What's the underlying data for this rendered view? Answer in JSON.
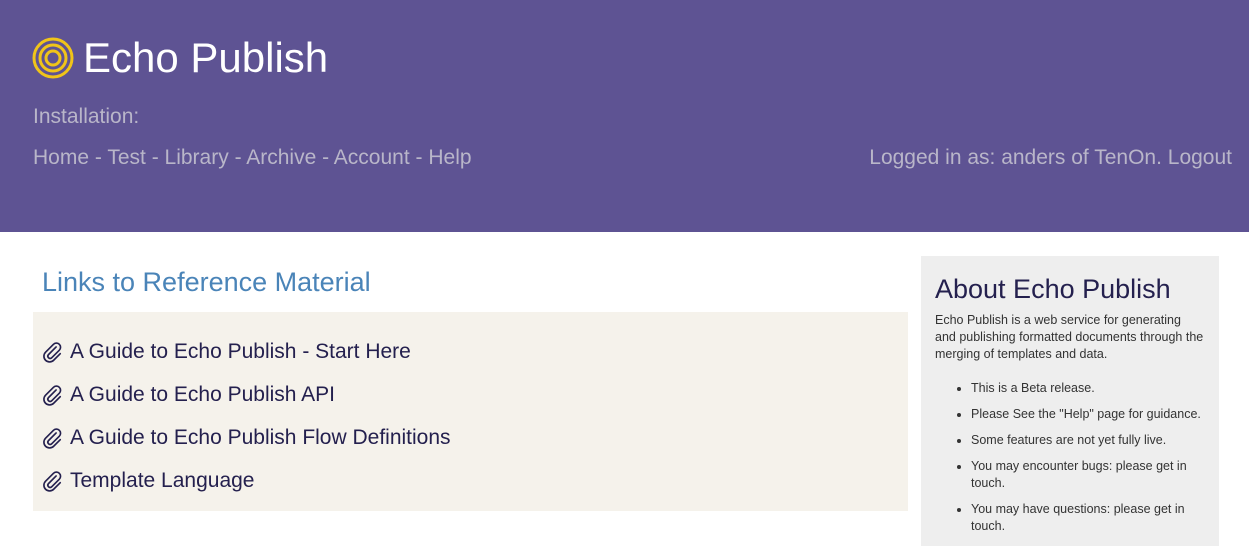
{
  "header": {
    "logo_icon": "concentric-circles-logo-icon",
    "brand_name": "Echo Publish",
    "installation_label": "Installation:",
    "nav": [
      {
        "label": "Home"
      },
      {
        "label": "Test"
      },
      {
        "label": "Library"
      },
      {
        "label": "Archive"
      },
      {
        "label": "Account"
      },
      {
        "label": "Help"
      }
    ],
    "nav_separator": "-",
    "login_text": "Logged in as: anders of TenOn.",
    "logout_label": "Logout"
  },
  "main": {
    "title": "Links to Reference Material",
    "links": [
      {
        "icon": "paperclip-icon",
        "label": "A Guide to Echo Publish - Start Here"
      },
      {
        "icon": "paperclip-icon",
        "label": "A Guide to Echo Publish API"
      },
      {
        "icon": "paperclip-icon",
        "label": "A Guide to Echo Publish Flow Definitions"
      },
      {
        "icon": "paperclip-icon",
        "label": "Template Language"
      }
    ]
  },
  "about": {
    "title": "About Echo Publish",
    "description": "Echo Publish is a web service for generating and publishing formatted documents through the merging of templates and data.",
    "bullets": [
      "This is a Beta release.",
      "Please See the \"Help\" page for guidance.",
      "Some features are not yet fully live.",
      "You may encounter bugs: please get in touch.",
      "You may have questions: please get in touch."
    ]
  },
  "colors": {
    "header_bg": "#5e5393",
    "header_muted_text": "#b9b6c9",
    "logo_yellow": "#f0c419",
    "section_title_blue": "#4a84b8",
    "links_box_bg": "#f5f2eb",
    "link_text": "#24204e",
    "sidebar_bg": "#eeeeee"
  }
}
